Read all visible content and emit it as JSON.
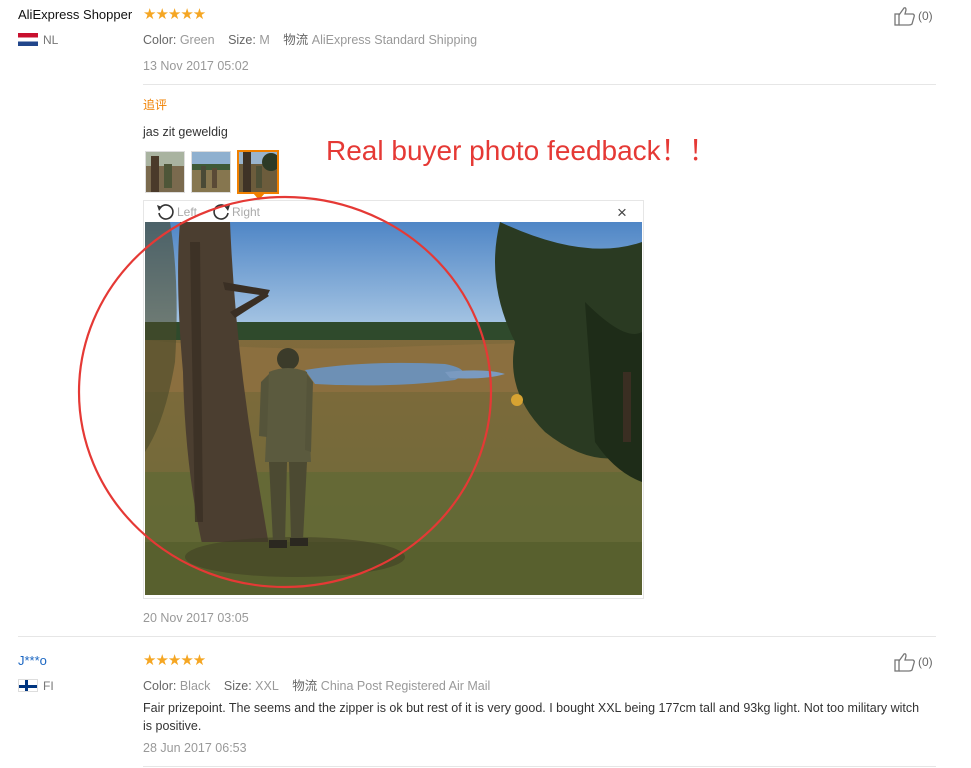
{
  "reviews": [
    {
      "name": "AliExpress Shopper",
      "country": "NL",
      "stars": "★★★★★",
      "meta": {
        "color_label": "Color:",
        "color": "Green",
        "size_label": "Size:",
        "size": "M",
        "ship_label": "物流",
        "ship": "AliExpress Standard Shipping"
      },
      "date": "13 Nov 2017 05:02",
      "likes": "(0)",
      "additional": {
        "label": "追评",
        "text": "jas zit geweldig",
        "date": "20 Nov 2017 03:05",
        "viewer": {
          "left": "Left",
          "right": "Right",
          "close": "×"
        }
      }
    },
    {
      "name": "J***o",
      "country": "FI",
      "stars": "★★★★★",
      "meta": {
        "color_label": "Color:",
        "color": "Black",
        "size_label": "Size:",
        "size": "XXL",
        "ship_label": "物流",
        "ship": "China Post Registered Air Mail"
      },
      "text": "Fair prizepoint. The seems and the zipper is ok but rest of it is very good. I bought XXL being 177cm tall and 93kg light. Not too military witch is positive.",
      "date": "28 Jun 2017 06:53",
      "likes": "(0)"
    }
  ],
  "annotation": {
    "text": "Real buyer photo feedback！！",
    "color": "#e53935"
  },
  "colors": {
    "star": "#f5a623",
    "accent": "#f08000",
    "link": "#1a66c2"
  }
}
